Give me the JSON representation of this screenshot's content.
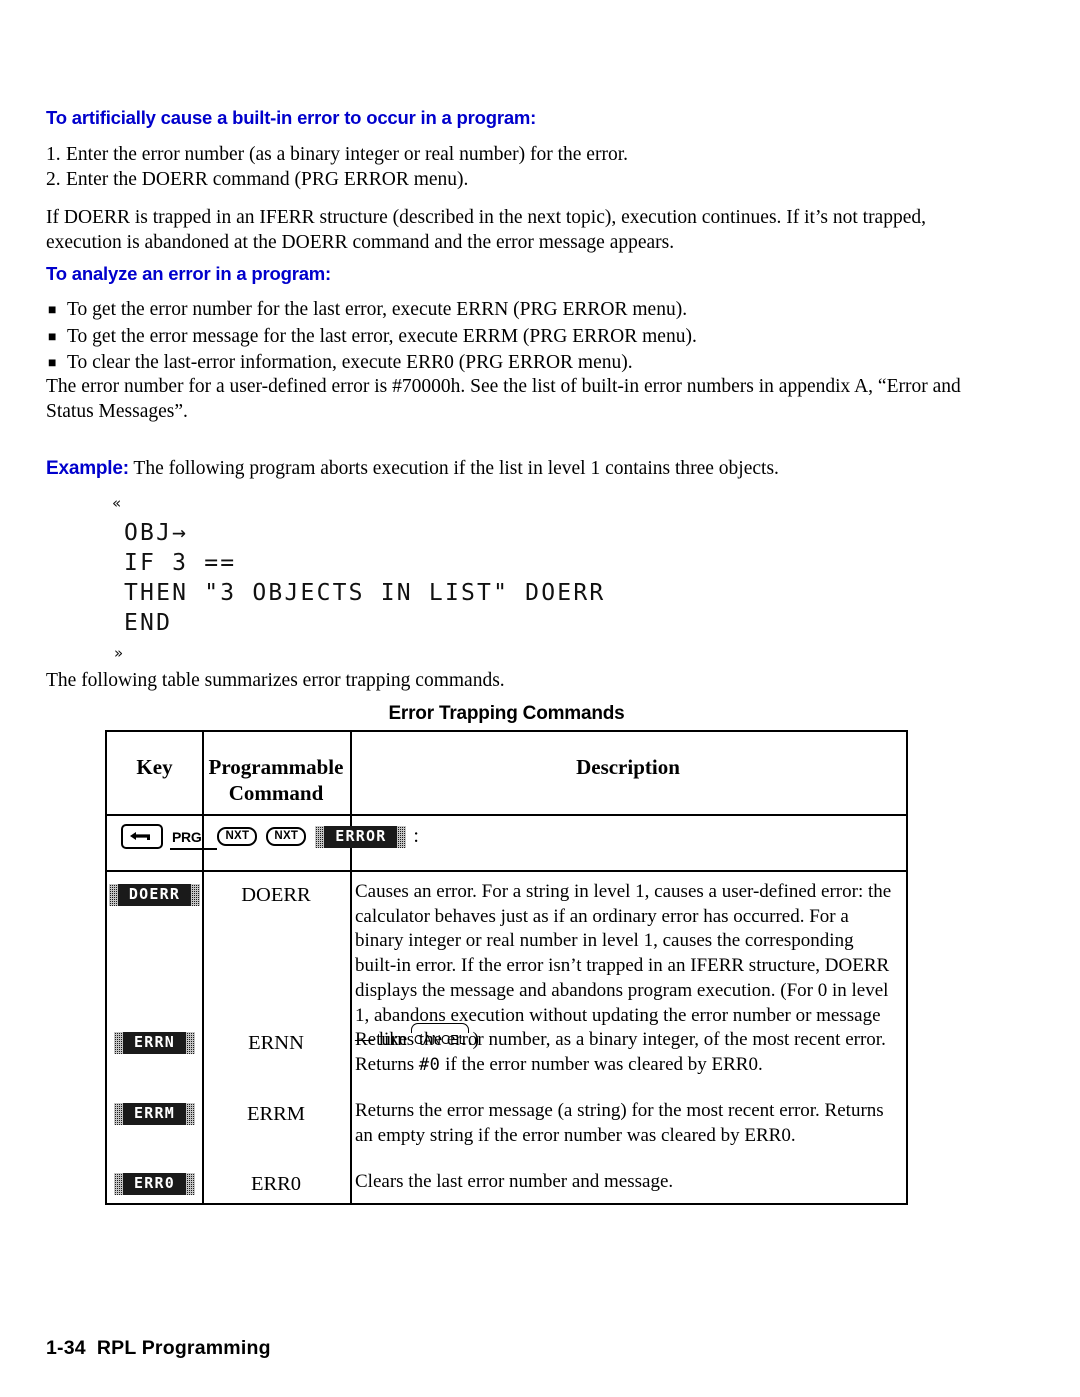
{
  "page": {
    "footer_page_number": "1-34",
    "footer_title": "RPL Programming"
  },
  "section_cause_error": {
    "heading": "To artificially cause a built-in error to occur in a program:",
    "steps": [
      {
        "num": "1.",
        "text": "Enter the error number (as a binary integer or real number) for the error."
      },
      {
        "num": "2.",
        "text": "Enter the DOERR command (PRG ERROR menu)."
      }
    ],
    "paragraph": "If DOERR is trapped in an IFERR structure (described in the next topic), execution continues. If it’s not trapped, execution is abandoned at the DOERR command and the error message appears."
  },
  "section_analyze_error": {
    "heading": "To analyze an error in a program:",
    "bullets": [
      "To get the error number for the last error, execute ERRN (PRG ERROR menu).",
      "To get the error message for the last error, execute ERRM (PRG ERROR menu).",
      "To clear the last-error information, execute ERR0 (PRG ERROR menu)."
    ],
    "bullet_marker": "■",
    "paragraph": "The error number for a user-defined error is #70000h. See the list of built-in error numbers in appendix A, “Error and Status Messages”."
  },
  "example": {
    "label": "Example:",
    "text": "The following program aborts execution if the list in level 1 contains three objects.",
    "code_lines": [
      "«",
      "OBJ→",
      "IF 3 ==",
      "THEN \"3 OBJECTS IN LIST\" DOERR",
      "END",
      "»"
    ],
    "after_text": "The following table summarizes error trapping commands."
  },
  "table": {
    "caption": "Error Trapping Commands",
    "headers": {
      "key": "Key",
      "command_line1": "Programmable",
      "command_line2": "Command",
      "description": "Description"
    },
    "key_sequence": {
      "shift_key": "left-shift",
      "prg_label": "PRG",
      "nxt_label_1": "NXT",
      "nxt_label_2": "NXT",
      "menu_softkey": "ERROR",
      "trailing": ":"
    },
    "rows": [
      {
        "softkey": "DOERR",
        "command": "DOERR",
        "description_pre": "Causes an error. For a string in level 1, causes a user-defined error: the calculator behaves just as if an ordinary error has occurred. For a binary integer or real number in level 1, causes the corresponding built-in error. If the error isn’t trapped in an IFERR structure, DOERR displays the message and abandons program execution. (For 0 in level 1, abandons execution without updating the error number or message — like ",
        "description_key": "CANCEL",
        "description_post": ".)"
      },
      {
        "softkey": "ERRN",
        "command": "ERNN",
        "description_pre": "Returns the error number, as a binary integer, of the most recent error. Returns ",
        "description_mono": "#0",
        "description_post": " if the error number was cleared by ERR0."
      },
      {
        "softkey": "ERRM",
        "command": "ERRM",
        "description_pre": "Returns the error message (a string) for the most recent error. Returns an empty string if the error number was cleared by ERR0."
      },
      {
        "softkey": "ERR0",
        "command": "ERR0",
        "description_pre": "Clears the last error number and message."
      }
    ]
  }
}
